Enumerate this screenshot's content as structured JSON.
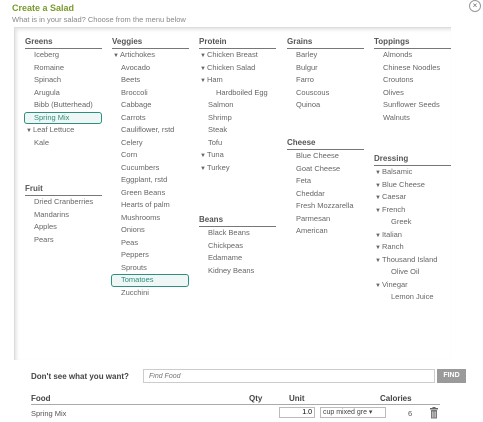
{
  "header": {
    "title": "Create a Salad",
    "subtitle": "What is in your salad? Choose from the menu below",
    "close_label": "×"
  },
  "columns": [
    {
      "categories": [
        {
          "heading": "Greens",
          "items": [
            {
              "label": "Iceberg"
            },
            {
              "label": "Romaine"
            },
            {
              "label": "Spinach"
            },
            {
              "label": "Arugula"
            },
            {
              "label": "Bibb (Butterhead)"
            },
            {
              "label": "Spring Mix",
              "selected": true
            },
            {
              "label": "Leaf Lettuce",
              "toggle": true
            },
            {
              "label": "Kale"
            }
          ]
        },
        {
          "heading": "Fruit",
          "items": [
            {
              "label": "Dried Cranberries"
            },
            {
              "label": "Mandarins"
            },
            {
              "label": "Apples"
            },
            {
              "label": "Pears"
            }
          ]
        }
      ]
    },
    {
      "categories": [
        {
          "heading": "Veggies",
          "items": [
            {
              "label": "Artichokes",
              "toggle": true
            },
            {
              "label": "Avocado"
            },
            {
              "label": "Beets"
            },
            {
              "label": "Broccoli"
            },
            {
              "label": "Cabbage"
            },
            {
              "label": "Carrots"
            },
            {
              "label": "Cauliflower, rstd"
            },
            {
              "label": "Celery"
            },
            {
              "label": "Corn"
            },
            {
              "label": "Cucumbers"
            },
            {
              "label": "Eggplant, rstd"
            },
            {
              "label": "Green Beans"
            },
            {
              "label": "Hearts of palm"
            },
            {
              "label": "Mushrooms"
            },
            {
              "label": "Onions"
            },
            {
              "label": "Peas"
            },
            {
              "label": "Peppers"
            },
            {
              "label": "Sprouts"
            },
            {
              "label": "Tomatoes",
              "selected": true
            },
            {
              "label": "Zucchini"
            }
          ]
        }
      ]
    },
    {
      "categories": [
        {
          "heading": "Protein",
          "items": [
            {
              "label": "Chicken Breast",
              "toggle": true
            },
            {
              "label": "Chicken Salad",
              "toggle": true
            },
            {
              "label": "Ham",
              "toggle": true
            },
            {
              "label": "Hardboiled Egg",
              "sub": true
            },
            {
              "label": "Salmon"
            },
            {
              "label": "Shrimp"
            },
            {
              "label": "Steak"
            },
            {
              "label": "Tofu"
            },
            {
              "label": "Tuna",
              "toggle": true
            },
            {
              "label": "Turkey",
              "toggle": true
            }
          ]
        },
        {
          "heading": "Beans",
          "items": [
            {
              "label": "Black Beans"
            },
            {
              "label": "Chickpeas"
            },
            {
              "label": "Edamame"
            },
            {
              "label": "Kidney Beans"
            }
          ]
        }
      ]
    },
    {
      "categories": [
        {
          "heading": "Grains",
          "items": [
            {
              "label": "Barley"
            },
            {
              "label": "Bulgur"
            },
            {
              "label": "Farro"
            },
            {
              "label": "Couscous"
            },
            {
              "label": "Quinoa"
            }
          ]
        },
        {
          "heading": "Cheese",
          "items": [
            {
              "label": "Blue Cheese"
            },
            {
              "label": "Goat Cheese"
            },
            {
              "label": "Feta"
            },
            {
              "label": "Cheddar"
            },
            {
              "label": "Fresh Mozzarella"
            },
            {
              "label": "Parmesan"
            },
            {
              "label": "American"
            }
          ]
        }
      ]
    },
    {
      "categories": [
        {
          "heading": "Toppings",
          "items": [
            {
              "label": "Almonds"
            },
            {
              "label": "Chinese Noodles"
            },
            {
              "label": "Croutons"
            },
            {
              "label": "Olives"
            },
            {
              "label": "Sunflower Seeds"
            },
            {
              "label": "Walnuts"
            }
          ]
        },
        {
          "heading": "Dressing",
          "items": [
            {
              "label": "Balsamic",
              "toggle": true
            },
            {
              "label": "Blue Cheese",
              "toggle": true
            },
            {
              "label": "Caesar",
              "toggle": true
            },
            {
              "label": "French",
              "toggle": true
            },
            {
              "label": "Greek",
              "sub": true
            },
            {
              "label": "Italian",
              "toggle": true
            },
            {
              "label": "Ranch",
              "toggle": true
            },
            {
              "label": "Thousand Island",
              "toggle": true
            },
            {
              "label": "Olive Oil",
              "sub": true
            },
            {
              "label": "Vinegar",
              "toggle": true
            },
            {
              "label": "Lemon Juice",
              "sub": true
            }
          ]
        }
      ]
    }
  ],
  "search": {
    "label": "Don't see what you want?",
    "placeholder": "Find Food",
    "button_label": "FIND"
  },
  "table": {
    "headers": {
      "food": "Food",
      "qty": "Qty",
      "unit": "Unit",
      "calories": "Calories"
    },
    "rows": [
      {
        "food": "Spring Mix",
        "qty": "1.0",
        "unit": "cup mixed gre",
        "calories": "6"
      }
    ]
  },
  "colors": {
    "title": "#7a9a2c",
    "selected_border": "#2f8f7f",
    "find_button": "#9a9a9a"
  }
}
